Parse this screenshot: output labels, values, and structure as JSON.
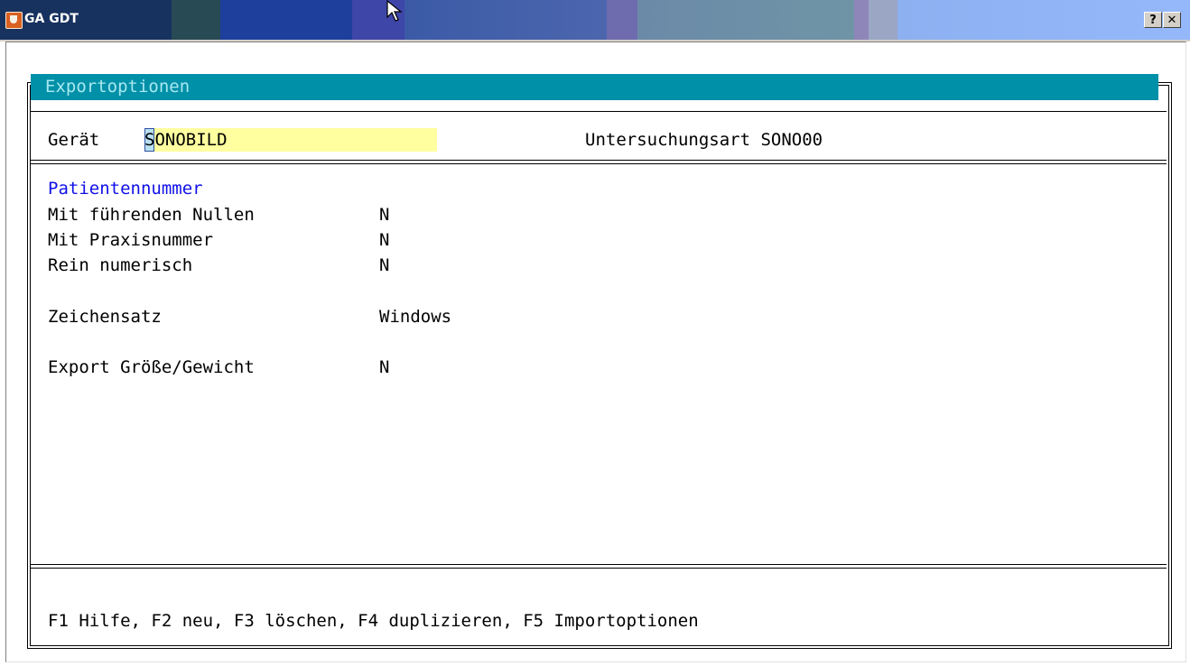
{
  "window": {
    "title": "GA GDT",
    "help_button": "?",
    "close_button": "✕"
  },
  "panel": {
    "header": "Exportoptionen"
  },
  "device": {
    "label": "Gerät",
    "value_first": "S",
    "value_rest": "ONOBILD",
    "exam_type": "Untersuchungsart SONO00"
  },
  "options": {
    "section_title": "Patientennummer",
    "rows": [
      {
        "label": "Mit führenden Nullen",
        "value": "N"
      },
      {
        "label": "Mit Praxisnummer",
        "value": "N"
      },
      {
        "label": "Rein numerisch",
        "value": "N"
      },
      {
        "label": "Zeichensatz",
        "value": "Windows"
      },
      {
        "label": "Export Größe/Gewicht",
        "value": "N"
      }
    ]
  },
  "footer": {
    "hotkeys": "F1 Hilfe, F2 neu, F3 löschen, F4 duplizieren, F5 Importoptionen"
  }
}
